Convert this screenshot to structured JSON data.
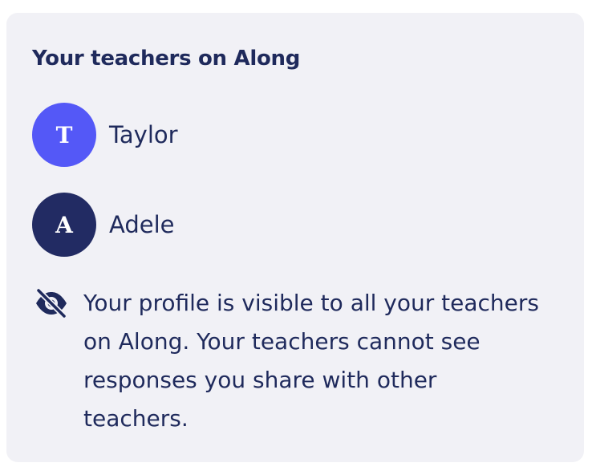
{
  "panel": {
    "title": "Your teachers on Along",
    "teachers": [
      {
        "initial": "T",
        "name": "Taylor",
        "avatar_color": "#5458f7"
      },
      {
        "initial": "A",
        "name": "Adele",
        "avatar_color": "#222b63"
      }
    ],
    "privacy_notice": {
      "icon": "eye-slash-icon",
      "text": "Your profile is visible to all your teachers on Along. Your teachers cannot see responses you share with other teachers."
    }
  },
  "colors": {
    "card_background": "#f1f1f6",
    "text": "#1f2a5c"
  }
}
